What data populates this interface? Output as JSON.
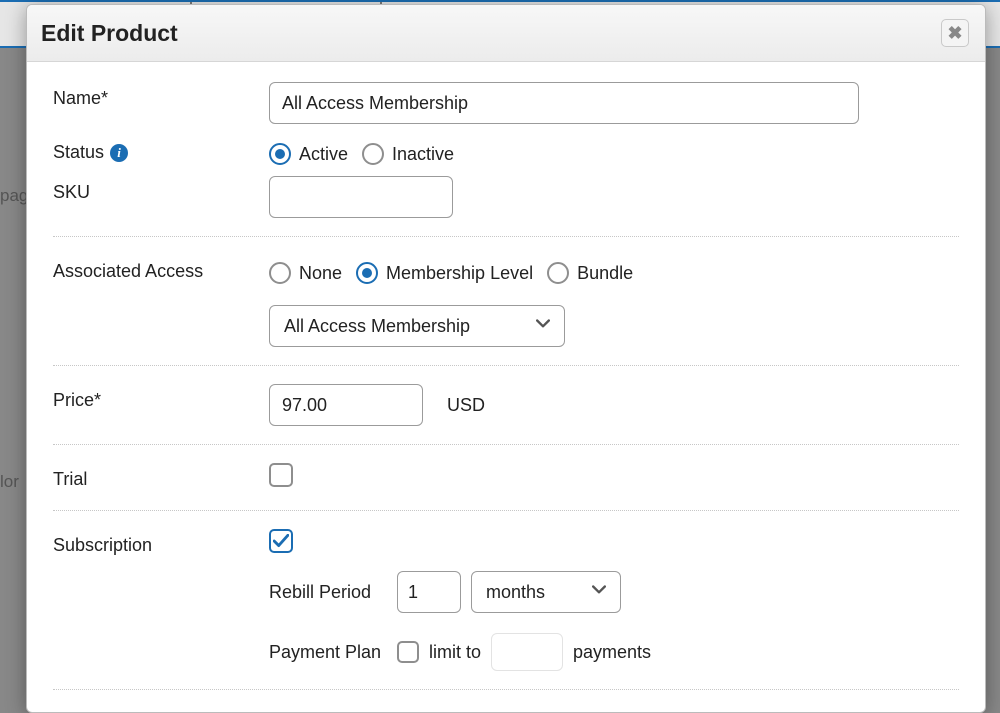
{
  "backdrop": {
    "text_left": "pag",
    "text_bottom": "lor"
  },
  "modal": {
    "title": "Edit Product",
    "close_icon": "close-icon",
    "fields": {
      "name": {
        "label": "Name*",
        "value": "All Access Membership"
      },
      "status": {
        "label": "Status",
        "options": {
          "active": "Active",
          "inactive": "Inactive"
        },
        "selected": "active"
      },
      "sku": {
        "label": "SKU",
        "value": ""
      },
      "associated_access": {
        "label": "Associated Access",
        "options": {
          "none": "None",
          "membership_level": "Membership Level",
          "bundle": "Bundle"
        },
        "selected": "membership_level",
        "dropdown_value": "All Access Membership"
      },
      "price": {
        "label": "Price*",
        "value": "97.00",
        "currency": "USD"
      },
      "trial": {
        "label": "Trial",
        "checked": false
      },
      "subscription": {
        "label": "Subscription",
        "checked": true,
        "rebill": {
          "label": "Rebill Period",
          "value": "1",
          "unit": "months"
        },
        "payment_plan": {
          "label": "Payment Plan",
          "checked": false,
          "prefix": "limit to",
          "value": "",
          "suffix": "payments"
        }
      }
    }
  }
}
